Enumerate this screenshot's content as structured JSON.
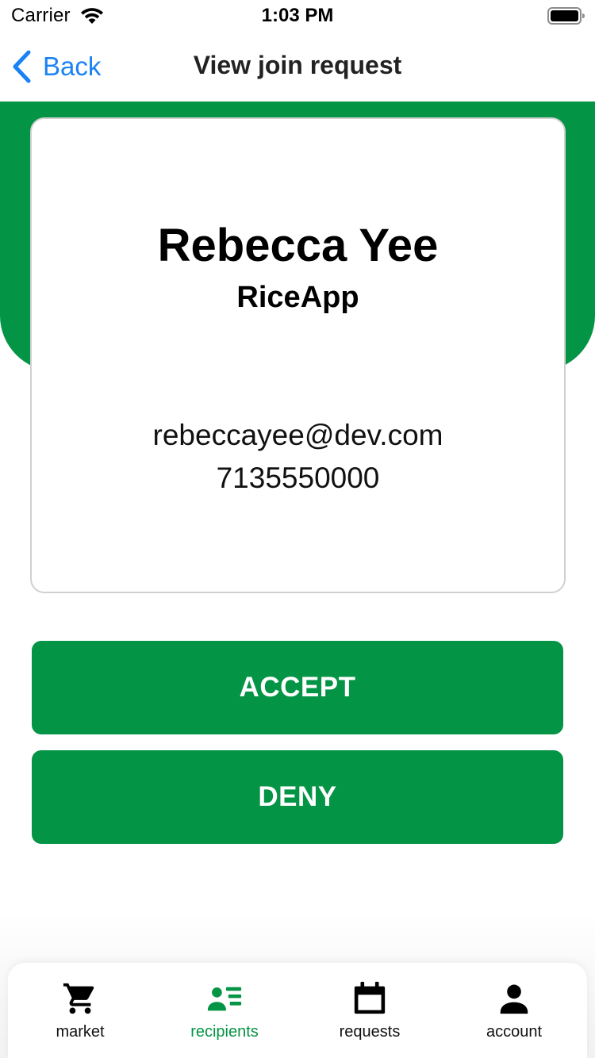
{
  "status_bar": {
    "carrier": "Carrier",
    "time": "1:03 PM"
  },
  "nav": {
    "back_label": "Back",
    "title": "View join request"
  },
  "request": {
    "name": "Rebecca Yee",
    "organization": "RiceApp",
    "email": "rebeccayee@dev.com",
    "phone": "7135550000"
  },
  "actions": {
    "accept_label": "ACCEPT",
    "deny_label": "DENY"
  },
  "tab_bar": {
    "active_tab": "recipients",
    "items": [
      {
        "id": "market",
        "label": "market",
        "icon": "cart-icon"
      },
      {
        "id": "recipients",
        "label": "recipients",
        "icon": "recipients-icon"
      },
      {
        "id": "requests",
        "label": "requests",
        "icon": "calendar-icon"
      },
      {
        "id": "account",
        "label": "account",
        "icon": "person-icon"
      }
    ]
  },
  "colors": {
    "brand_green": "#049445",
    "ios_blue": "#1a82f5"
  }
}
